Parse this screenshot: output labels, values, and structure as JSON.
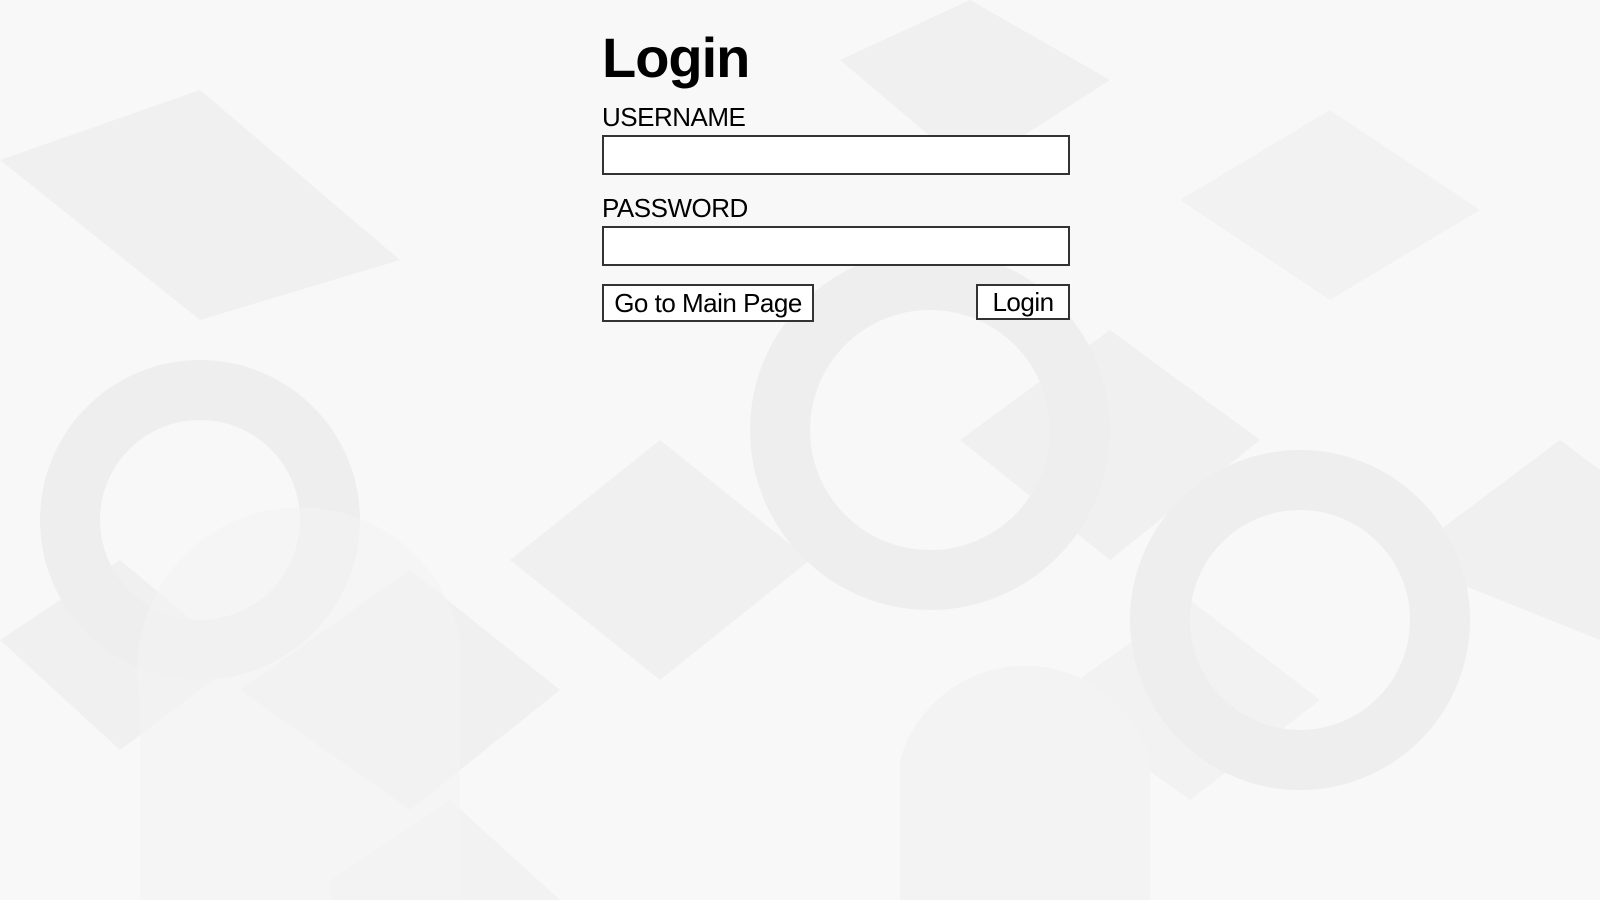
{
  "page": {
    "title": "Login",
    "background_color": "#f7f7f7"
  },
  "form": {
    "username_label": "USERNAME",
    "username_value": "",
    "password_label": "PASSWORD",
    "password_value": ""
  },
  "buttons": {
    "main_page_label": "Go to Main Page",
    "login_label": "Login"
  }
}
